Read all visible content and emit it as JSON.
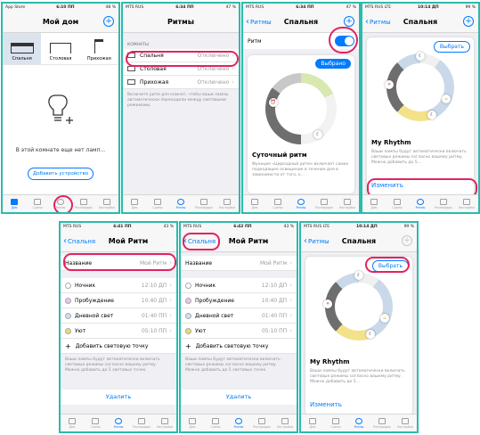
{
  "phone1": {
    "status": {
      "carrier": "App Store",
      "time": "6:10 ПП",
      "battery": "48 %"
    },
    "title": "Мой дом",
    "rooms": [
      "Спальня",
      "Столовая",
      "Прихожая"
    ],
    "empty_text": "В этой комнате еще нет ламп...",
    "add_button": "Добавить устройство",
    "tabs": [
      "Дом",
      "Сцены",
      "Ритмы",
      "Распорядок",
      "Настройки"
    ]
  },
  "phone2": {
    "status": {
      "carrier": "MTS RUS",
      "time": "6:34 ПП",
      "battery": "47 %"
    },
    "title": "Ритмы",
    "section": "КОМНАТЫ",
    "rooms": [
      {
        "name": "Спальня",
        "state": "Отключено"
      },
      {
        "name": "Столовая",
        "state": "Отключено"
      },
      {
        "name": "Прихожая",
        "state": "Отключено"
      }
    ],
    "hint": "Включите ритм для комнат, чтобы ваши лампы автоматически переходили между световыми режимами.",
    "tabs": [
      "Дом",
      "Сцены",
      "Ритмы",
      "Распорядок",
      "Настройки"
    ]
  },
  "phone3": {
    "status": {
      "carrier": "MTS RUS",
      "time": "6:34 ПП",
      "battery": "47 %"
    },
    "back": "Ритмы",
    "title": "Спальня",
    "toggle_label": "Ритм",
    "toggle_on": true,
    "badge": "Выбрано",
    "card_title": "Суточный ритм",
    "card_desc": "Функция «Циркадный ритм» включает самое подходящее освещение в течение дня в зависимости от того, к...",
    "tabs": [
      "Дом",
      "Сцены",
      "Ритмы",
      "Распорядок",
      "Настройки"
    ]
  },
  "phone4": {
    "status": {
      "carrier": "MTS RUS LTE",
      "time": "10:14 ДП",
      "battery": "99 %"
    },
    "back": "Ритмы",
    "title": "Спальня",
    "select_button": "Выбрать",
    "card_title": "My Rhythm",
    "card_desc": "Ваши лампы будут автоматически включать световые режимы согласно вашему ритму. Можно добавить до 5...",
    "edit_link": "Изменить",
    "tabs": [
      "Дом",
      "Сцены",
      "Ритмы",
      "Распорядок",
      "Настройки"
    ]
  },
  "phone5": {
    "status": {
      "carrier": "MTS RUS",
      "time": "6:41 ПП",
      "battery": "43 %"
    },
    "back": "Спальня",
    "title": "Мой Ритм",
    "name_label": "Название",
    "name_value": "Мой Ритм",
    "items": [
      {
        "label": "Ночник",
        "time": "12:10 ДП"
      },
      {
        "label": "Пробуждение",
        "time": "10:40 ДП"
      },
      {
        "label": "Дневной свет",
        "time": "01:40 ПП"
      },
      {
        "label": "Уют",
        "time": "05:10 ПП"
      }
    ],
    "add_point": "Добавить световую точку",
    "hint": "Ваши лампы будут автоматически включать световые режимы согласно вашему ритму. Можно добавить до 5 световых точек.",
    "delete": "Удалить",
    "tabs": [
      "Дом",
      "Сцены",
      "Ритмы",
      "Распорядок",
      "Настройки"
    ]
  },
  "phone6": {
    "status": {
      "carrier": "MTS RUS",
      "time": "6:42 ПП",
      "battery": "43 %"
    },
    "back": "Спальня",
    "title": "Мой Ритм",
    "name_label": "Название",
    "name_value": "Мой Ритм",
    "items": [
      {
        "label": "Ночник",
        "time": "12:10 ДП"
      },
      {
        "label": "Пробуждение",
        "time": "10:40 ДП"
      },
      {
        "label": "Дневной свет",
        "time": "01:40 ПП"
      },
      {
        "label": "Уют",
        "time": "05:10 ПП"
      }
    ],
    "add_point": "Добавить световую точку",
    "hint": "Ваши лампы будут автоматически включать световые режимы согласно вашему ритму. Можно добавить до 5 световых точек.",
    "delete": "Удалить",
    "tabs": [
      "Дом",
      "Сцены",
      "Ритмы",
      "Распорядок",
      "Настройки"
    ]
  },
  "phone7": {
    "status": {
      "carrier": "MTS RUS LTE",
      "time": "10:14 ДП",
      "battery": "99 %"
    },
    "back": "Ритмы",
    "title": "Спальня",
    "select_button": "Выбрать",
    "card_title": "My Rhythm",
    "card_desc": "Ваши лампы будут автоматически включать световые режимы согласно вашему ритму. Можно добавить до 5...",
    "edit_link": "Изменить",
    "tabs": [
      "Дом",
      "Сцены",
      "Ритмы",
      "Распорядок",
      "Настройки"
    ]
  },
  "colors": {
    "accent": "#007aff",
    "highlight": "#e0245e",
    "frame": "#2bbbad"
  }
}
